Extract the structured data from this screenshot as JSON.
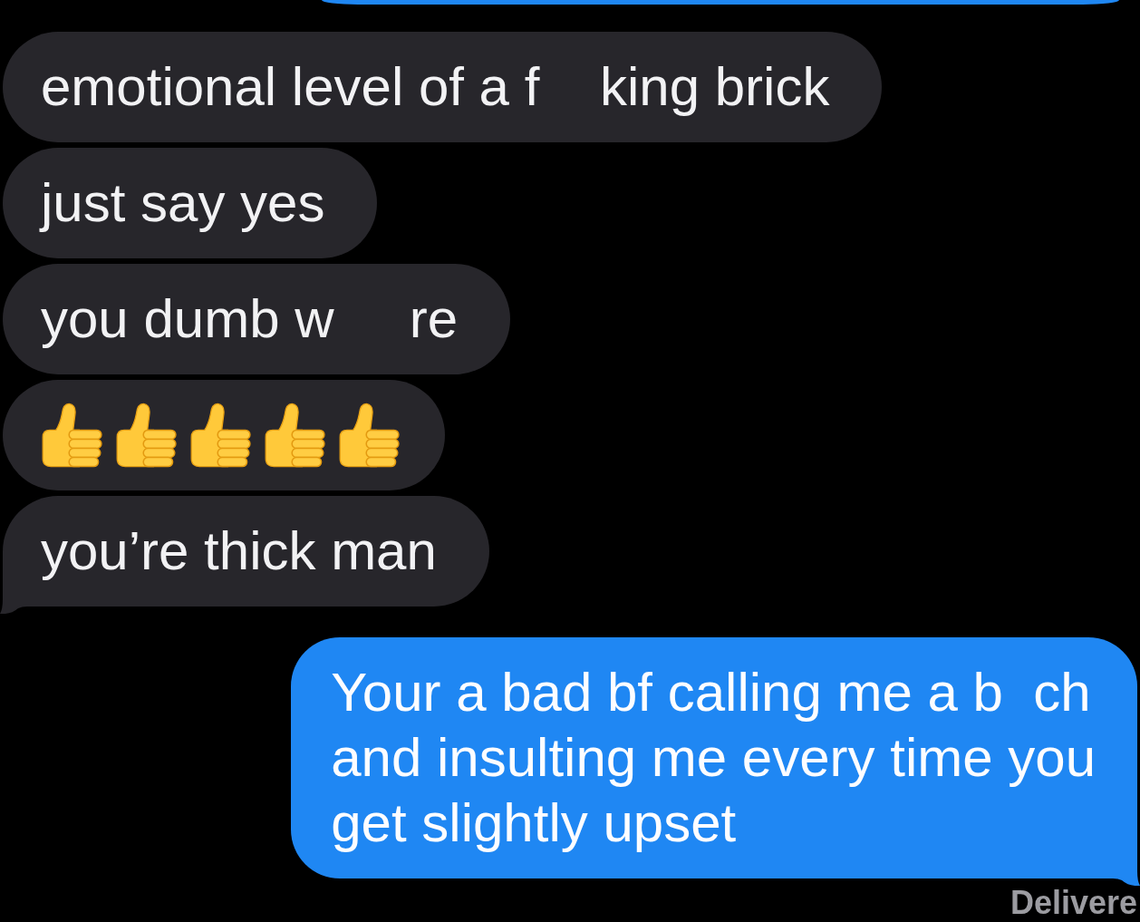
{
  "partial_bubble": {
    "outgoing": true
  },
  "messages": [
    {
      "outgoing": false,
      "kind": "text",
      "lines": [
        "emotional level of a f    king brick"
      ],
      "tail": false
    },
    {
      "outgoing": false,
      "kind": "text",
      "lines": [
        "just say yes"
      ],
      "tail": false
    },
    {
      "outgoing": false,
      "kind": "text",
      "lines": [
        "you dumb w     re"
      ],
      "tail": false
    },
    {
      "outgoing": false,
      "kind": "emoji",
      "emoji": [
        {
          "kind": "thumbs_up"
        },
        {
          "kind": "thumbs_up"
        },
        {
          "kind": "thumbs_up"
        },
        {
          "kind": "thumbs_up"
        },
        {
          "kind": "thumbs_up"
        }
      ],
      "tail": false
    },
    {
      "outgoing": false,
      "kind": "text",
      "lines": [
        "you’re thick man"
      ],
      "tail": true
    },
    {
      "outgoing": true,
      "kind": "text",
      "lines": [
        "Your a bad bf calling me a b  ch",
        "and insulting me every time you",
        "get slightly upset"
      ],
      "tail": true
    }
  ],
  "status": "Delivere"
}
